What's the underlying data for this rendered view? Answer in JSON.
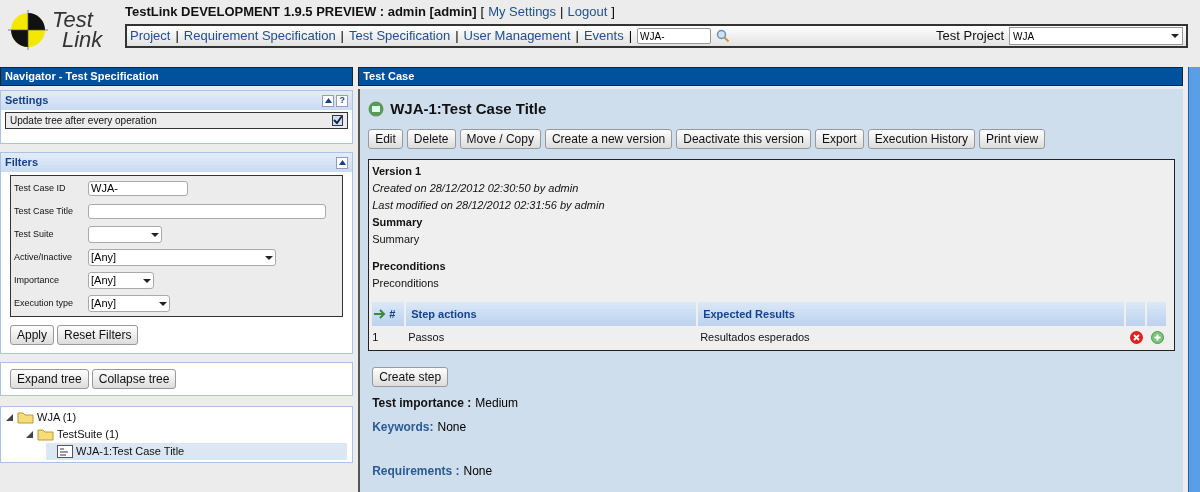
{
  "logo": {
    "line1": "Test",
    "line2": "Link"
  },
  "header": {
    "title": "TestLink DEVELOPMENT 1.9.5 PREVIEW : admin [admin]",
    "links": [
      "My Settings",
      "Logout"
    ],
    "open_bracket": "[",
    "close_bracket": "]",
    "separator": "|"
  },
  "menu": {
    "items": [
      "Project",
      "Requirement Specification",
      "Test Specification",
      "User Management",
      "Events"
    ],
    "search_value": "WJA-",
    "project_label": "Test Project",
    "project_value": "WJA"
  },
  "navigator": {
    "title": "Navigator - Test Specification",
    "settings": {
      "title": "Settings",
      "help": "?",
      "option": "Update tree after every operation",
      "checked": true
    },
    "filters": {
      "title": "Filters",
      "fields": [
        {
          "label": "Test Case ID",
          "kind": "text",
          "value": "WJA-"
        },
        {
          "label": "Test Case Title",
          "kind": "text"
        },
        {
          "label": "Test Suite",
          "kind": "select"
        },
        {
          "label": "Active/Inactive",
          "kind": "select",
          "value": "[Any]"
        },
        {
          "label": "Importance",
          "kind": "select",
          "value": "[Any]"
        },
        {
          "label": "Execution type",
          "kind": "select",
          "value": "[Any]"
        }
      ],
      "buttons": [
        "Apply",
        "Reset Filters"
      ]
    },
    "tree_buttons": [
      "Expand tree",
      "Collapse tree"
    ],
    "tree": [
      {
        "label": "WJA (1)",
        "kind": "folder",
        "expanded": true,
        "selected": false,
        "children": [
          {
            "label": "TestSuite (1)",
            "kind": "folder",
            "expanded": true,
            "selected": false,
            "children": [
              {
                "label": "WJA-1:Test Case Title",
                "kind": "case",
                "selected": true
              }
            ]
          }
        ]
      }
    ]
  },
  "test_case": {
    "panel_title": "Test Case",
    "title": "WJA-1:Test Case Title",
    "buttons": [
      "Edit",
      "Delete",
      "Move / Copy",
      "Create a new version",
      "Deactivate this version",
      "Export",
      "Execution History",
      "Print view"
    ],
    "version": "Version 1",
    "created": "Created on 28/12/2012 02:30:50  by admin",
    "modified": "Last modified on  28/12/2012 02:31:56  by admin",
    "summary_label": "Summary",
    "summary": "Summary",
    "preconditions_label": "Preconditions",
    "preconditions": "Preconditions",
    "steps": {
      "columns": [
        "#",
        "Step actions",
        "Expected Results"
      ],
      "rows": [
        {
          "number": "1",
          "action": "Passos",
          "expected": "Resultados esperados"
        }
      ]
    },
    "create_step": "Create step",
    "importance_label": "Test importance :",
    "importance": "Medium",
    "keywords_label": "Keywords:",
    "keywords": "None",
    "requirements_label": "Requirements :",
    "requirements": "None"
  }
}
